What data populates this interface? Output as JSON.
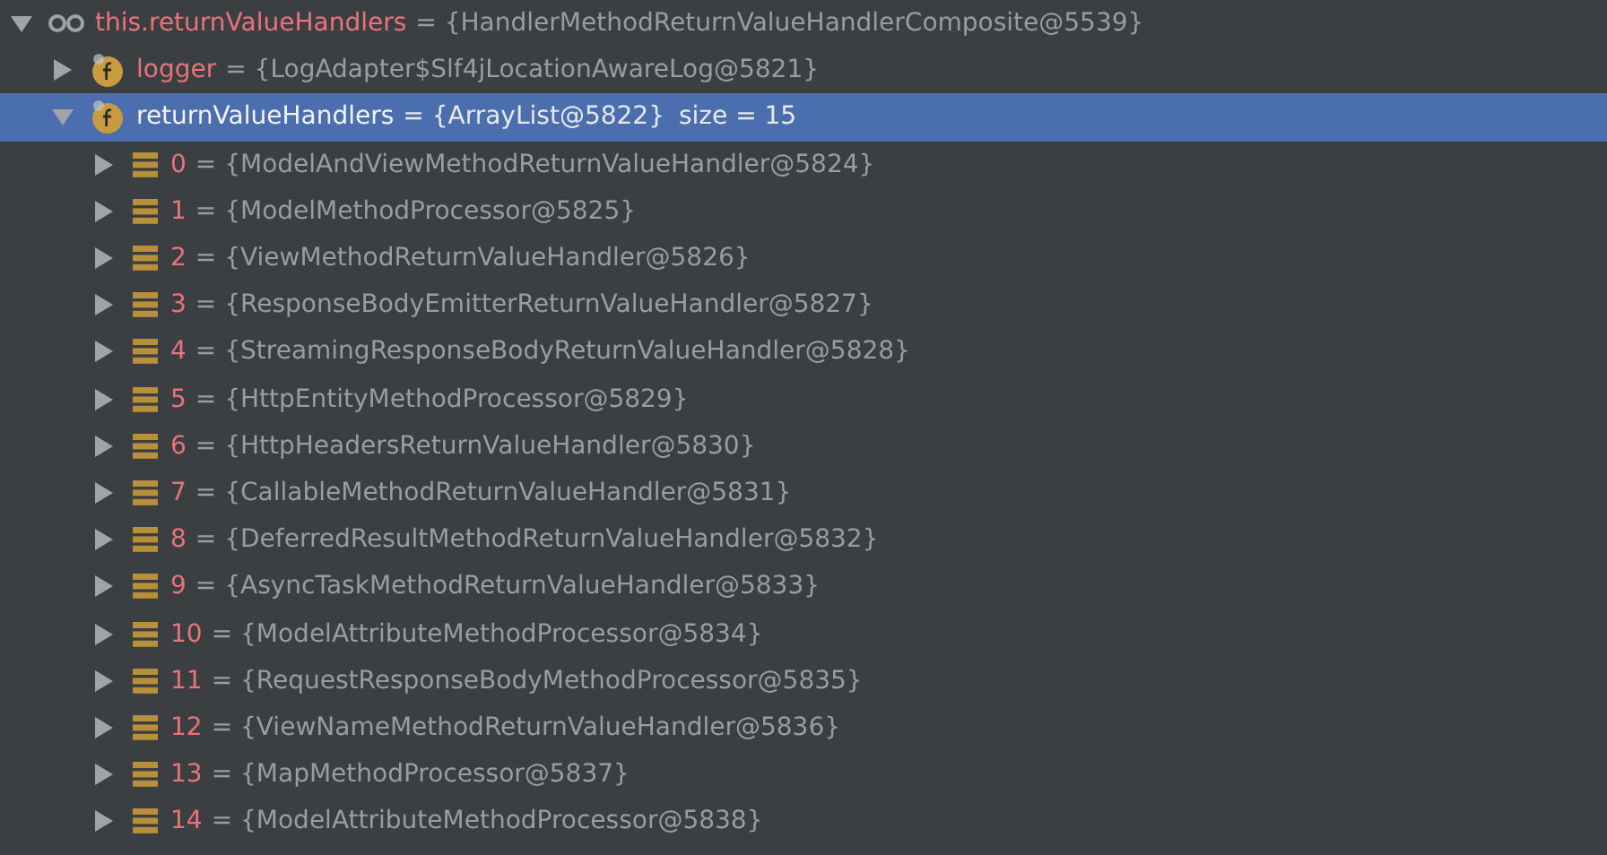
{
  "tree": [
    {
      "kind": "watch",
      "name": "this.returnValueHandlers",
      "value": "= {HandlerMethodReturnValueHandlerComposite@5539}",
      "expanded": true,
      "selected": false,
      "children": [
        {
          "kind": "field",
          "name": "logger",
          "value": "= {LogAdapter$Slf4jLocationAwareLog@5821}",
          "expanded": false,
          "selected": false
        },
        {
          "kind": "field",
          "name": "returnValueHandlers",
          "value": "= {ArrayList@5822}",
          "extra": "size = 15",
          "expanded": true,
          "selected": true,
          "children": [
            {
              "kind": "element",
              "name": "0",
              "value": "= {ModelAndViewMethodReturnValueHandler@5824}",
              "expanded": false,
              "selected": false
            },
            {
              "kind": "element",
              "name": "1",
              "value": "= {ModelMethodProcessor@5825}",
              "expanded": false,
              "selected": false
            },
            {
              "kind": "element",
              "name": "2",
              "value": "= {ViewMethodReturnValueHandler@5826}",
              "expanded": false,
              "selected": false
            },
            {
              "kind": "element",
              "name": "3",
              "value": "= {ResponseBodyEmitterReturnValueHandler@5827}",
              "expanded": false,
              "selected": false
            },
            {
              "kind": "element",
              "name": "4",
              "value": "= {StreamingResponseBodyReturnValueHandler@5828}",
              "expanded": false,
              "selected": false
            },
            {
              "kind": "element",
              "name": "5",
              "value": "= {HttpEntityMethodProcessor@5829}",
              "expanded": false,
              "selected": false
            },
            {
              "kind": "element",
              "name": "6",
              "value": "= {HttpHeadersReturnValueHandler@5830}",
              "expanded": false,
              "selected": false
            },
            {
              "kind": "element",
              "name": "7",
              "value": "= {CallableMethodReturnValueHandler@5831}",
              "expanded": false,
              "selected": false
            },
            {
              "kind": "element",
              "name": "8",
              "value": "= {DeferredResultMethodReturnValueHandler@5832}",
              "expanded": false,
              "selected": false
            },
            {
              "kind": "element",
              "name": "9",
              "value": "= {AsyncTaskMethodReturnValueHandler@5833}",
              "expanded": false,
              "selected": false
            },
            {
              "kind": "element",
              "name": "10",
              "value": "= {ModelAttributeMethodProcessor@5834}",
              "expanded": false,
              "selected": false
            },
            {
              "kind": "element",
              "name": "11",
              "value": "= {RequestResponseBodyMethodProcessor@5835}",
              "expanded": false,
              "selected": false
            },
            {
              "kind": "element",
              "name": "12",
              "value": "= {ViewNameMethodReturnValueHandler@5836}",
              "expanded": false,
              "selected": false
            },
            {
              "kind": "element",
              "name": "13",
              "value": "= {MapMethodProcessor@5837}",
              "expanded": false,
              "selected": false
            },
            {
              "kind": "element",
              "name": "14",
              "value": "= {ModelAttributeMethodProcessor@5838}",
              "expanded": false,
              "selected": false
            }
          ]
        }
      ]
    }
  ]
}
